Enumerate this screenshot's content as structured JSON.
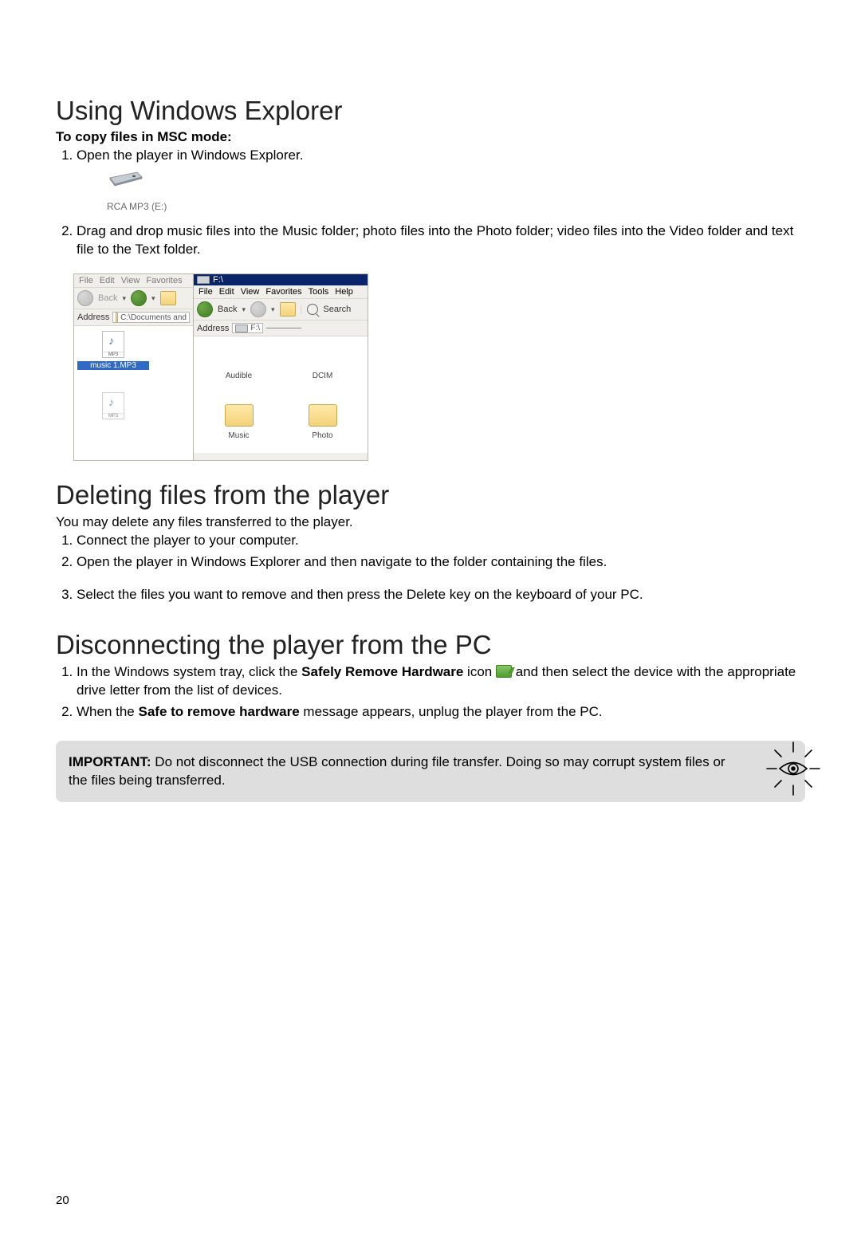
{
  "section1": {
    "heading": "Using Windows Explorer",
    "subheading": "To copy files in MSC mode:",
    "steps": [
      "Open the player in Windows Explorer.",
      "Drag and drop music files into the Music folder; photo files into the Photo folder; video files into the Video folder and text file to the Text folder."
    ]
  },
  "drive_label": "RCA MP3 (E:)",
  "explorer": {
    "left": {
      "menu": [
        "File",
        "Edit",
        "View",
        "Favorites"
      ],
      "back_label": "Back",
      "address_label": "Address",
      "address_text": "C:\\Documents and",
      "file1": "music 1.MP3"
    },
    "right": {
      "title": "F:\\",
      "menu": [
        "File",
        "Edit",
        "View",
        "Favorites",
        "Tools",
        "Help"
      ],
      "back_label": "Back",
      "search_label": "Search",
      "address_label": "Address",
      "address_text": "F:\\",
      "folders": [
        "Audible",
        "DCIM",
        "Music",
        "Photo"
      ]
    }
  },
  "section2": {
    "heading": "Deleting files from the player",
    "intro": "You may delete any files transferred to the player.",
    "steps": [
      "Connect the player to your computer.",
      "Open the player in Windows Explorer and then navigate to the folder containing the files.",
      "Select the files you want to remove and then press the Delete key on the keyboard of your PC."
    ]
  },
  "section3": {
    "heading": "Disconnecting the player from the PC",
    "step1_a": "In the Windows system tray, click the ",
    "step1_b": "Safely Remove Hardware",
    "step1_c": " icon ",
    "step1_d": " and then select the device with the appropriate drive letter from the list of devices.",
    "step2_a": "When the ",
    "step2_b": "Safe to remove hardware",
    "step2_c": " message appears, unplug the player from the PC."
  },
  "important": {
    "label": "IMPORTANT:",
    "text": " Do not disconnect the USB connection during file transfer. Doing so may corrupt system files or the files being transferred."
  },
  "page_number": "20"
}
